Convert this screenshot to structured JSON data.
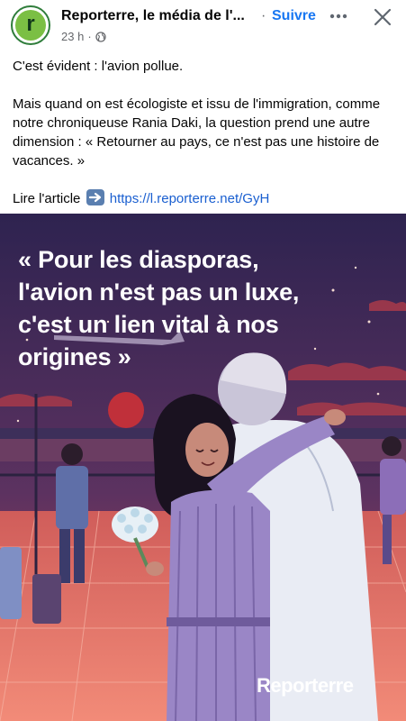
{
  "post": {
    "page_name": "Reporterre, le média de l'...",
    "separator": "·",
    "follow_label": "Suivre",
    "time": "23 h",
    "meta_dot": "·",
    "avatar_letter": "r",
    "privacy_icon": "globe-icon",
    "more_icon": "more-horizontal-icon",
    "close_icon": "close-icon",
    "text_line1": "C'est évident : l'avion pollue.",
    "text_para2": "Mais quand on est écologiste et issu de l'immigration, comme notre chroniqueuse Rania Daki, la question prend une autre dimension : « Retourner au pays, ce n'est pas une histoire de vacances. »",
    "read_label": "Lire l'article",
    "arrow_icon": "arrow-right-emoji-icon",
    "link": "https://l.reporterre.net/GyH"
  },
  "image": {
    "quote": "« Pour les diasporas, l'avion n'est pas un luxe, c'est un lien vital à nos origines »",
    "watermark": "Reporterre"
  },
  "colors": {
    "link": "#1877f2",
    "brand_green": "#7bbf44",
    "sky": "#3a2c5c",
    "horizon_red": "#c0303a",
    "floor": "#e8746a"
  }
}
